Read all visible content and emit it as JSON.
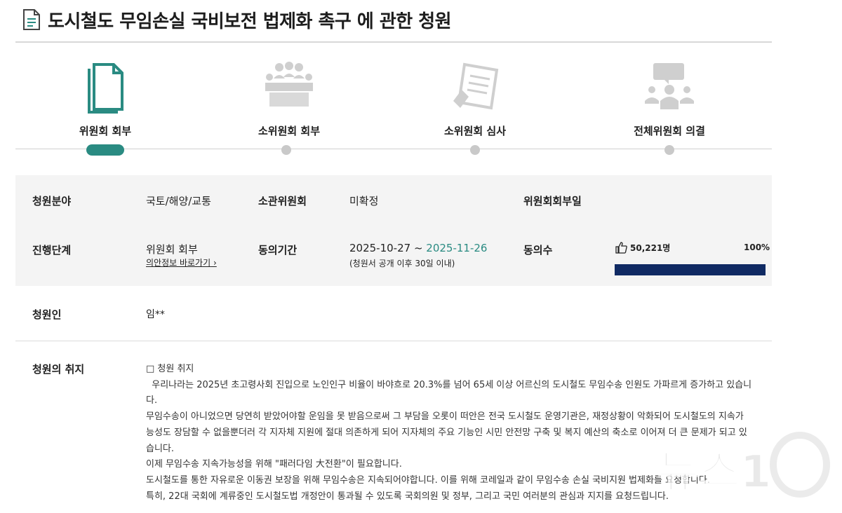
{
  "title": "도시철도 무임손실 국비보전 법제화 촉구 에 관한 청원",
  "steps": [
    {
      "label": "위원회 회부",
      "active": true,
      "icon": "documents-icon"
    },
    {
      "label": "소위원회 회부",
      "active": false,
      "icon": "meeting-icon"
    },
    {
      "label": "소위원회 심사",
      "active": false,
      "icon": "review-icon"
    },
    {
      "label": "전체위원회 의결",
      "active": false,
      "icon": "conference-icon"
    }
  ],
  "info": {
    "field_label": "청원분야",
    "field_value": "국토/해양/교통",
    "committee_label": "소관위원회",
    "committee_value": "미확정",
    "referral_date_label": "위원회회부일",
    "stage_label": "진행단계",
    "stage_value": "위원회 회부",
    "stage_link": "의안정보 바로가기",
    "period_label": "동의기간",
    "period_start": "2025-10-27",
    "period_separator": " ~ ",
    "period_end": "2025-11-26",
    "period_note": "(청원서 공개 이후 30일 이내)",
    "votes_label": "동의수",
    "votes_count": "50,221명",
    "votes_percent_text": "100%",
    "votes_fraction": 1.0
  },
  "petitioner": {
    "label": "청원인",
    "value": "임**"
  },
  "purpose": {
    "label": "청원의 취지",
    "lines": [
      "□ 청원 취지",
      "  우리나라는 2025년 초고령사회 진입으로 노인인구 비율이 바야흐로 20.3%를 넘어 65세 이상 어르신의 도시철도 무임수송 인원도 가파르게 증가하고 있습니",
      "다.",
      "무임수송이 아니었으면 당연히 받았어야할 운임을 못 받음으로써 그 부담을 오롯이 떠안은 전국 도시철도 운영기관은, 재정상황이 악화되어 도시철도의 지속가",
      "능성도 장담할 수 없을뿐더러 각 지자체 지원에 절대 의존하게 되어 지자체의 주요 기능인 시민 안전망 구축 및 복지 예산의 축소로 이어져 더 큰 문제가 되고 있",
      "습니다.",
      "이제 무임수송 지속가능성을 위해 \"패러다임 大전환\"이 필요합니다.",
      "도시철도를 통한 자유로운 이동권 보장을 위해 무임수송은 지속되어야합니다. 이를 위해 코레일과 같이 무임수송 손실 국비지원 법제화를 요청합니다.",
      "특히, 22대 국회에 계류중인 도시철도법 개정안이 통과될 수 있도록 국회의원 및 정부, 그리고 국민 여러분의 관심과 지지를 요청드립니다."
    ]
  },
  "watermark_text": "뉴스1",
  "colors": {
    "accent": "#2a8b82",
    "progress": "#102a63",
    "inactive": "#c9c9c9"
  }
}
